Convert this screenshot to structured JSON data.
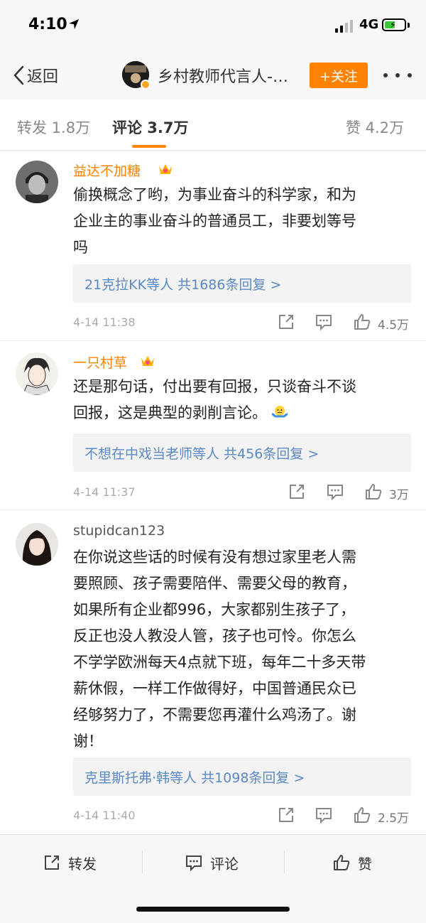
{
  "status_bar": {
    "time": "4:10",
    "network": "4G"
  },
  "nav": {
    "back_label": "返回",
    "title": "乡村教师代言人-…",
    "follow_label": "+关注"
  },
  "tabs": [
    {
      "label": "转发 1.8万"
    },
    {
      "label": "评论 3.7万",
      "active": true
    },
    {
      "label": "赞 4.2万"
    }
  ],
  "comments": [
    {
      "username": "益达不加糖",
      "vip": true,
      "lines": [
        "偷换概念了哟，为事业奋斗的科学家，和为",
        "企业主的事业奋斗的普通员工，非要划等号",
        "吗"
      ],
      "replies": "21克拉KK等人  共1686条回复 >",
      "time": "4-14 11:38",
      "likes": "4.5万"
    },
    {
      "username": "一只村草",
      "vip": true,
      "lines": [
        "还是那句话，付出要有回报，只谈奋斗不谈",
        "回报，这是典型的剥削言论。"
      ],
      "replies": "不想在中戏当老师等人  共456条回复 >",
      "time": "4-14 11:37",
      "likes": "3万"
    },
    {
      "username": "stupidcan123",
      "vip": false,
      "lines": [
        "在你说这些话的时候有没有想过家里老人需",
        "要照顾、孩子需要陪伴、需要父母的教育，",
        "如果所有企业都996，大家都别生孩子了，",
        "反正也没人教没人管，孩子也可怜。你怎么",
        "不学学欧洲每天4点就下班，每年二十多天带",
        "薪休假，一样工作做得好，中国普通民众已",
        "经够努力了，不需要您再灌什么鸡汤了。谢",
        "谢！"
      ],
      "replies": "克里斯托弗·韩等人  共1098条回复 >",
      "time": "4-14 11:40",
      "likes": "2.5万"
    }
  ],
  "bottom_bar": {
    "repost": "转发",
    "comment": "评论",
    "like": "赞"
  },
  "colors": {
    "accent": "#ff8200",
    "link": "#5b89c4"
  }
}
